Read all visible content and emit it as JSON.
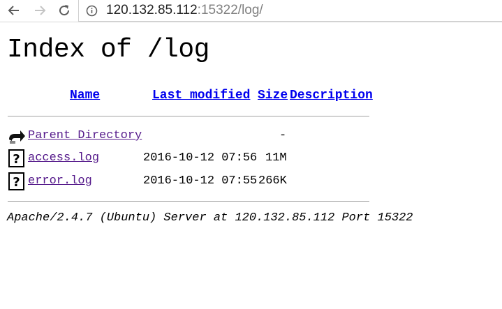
{
  "browser": {
    "url_host": "120.132.85.112",
    "url_rest": ":15322/log/"
  },
  "page": {
    "title": "Index of /log",
    "columns": {
      "name": "Name",
      "last_modified": "Last modified",
      "size": "Size",
      "description": "Description"
    },
    "rows": [
      {
        "icon": "back-folder-icon",
        "name": "Parent Directory",
        "modified": "",
        "size": "-",
        "description": ""
      },
      {
        "icon": "unknown-file-icon",
        "name": "access.log",
        "modified": "2016-10-12 07:56",
        "size": "11M",
        "description": ""
      },
      {
        "icon": "unknown-file-icon",
        "name": "error.log",
        "modified": "2016-10-12 07:55",
        "size": "266K",
        "description": ""
      }
    ],
    "footer": "Apache/2.4.7 (Ubuntu) Server at 120.132.85.112 Port 15322"
  },
  "colors": {
    "link": "#0000ee",
    "visited_link": "#551a8b",
    "rule": "#a0a0a0"
  }
}
